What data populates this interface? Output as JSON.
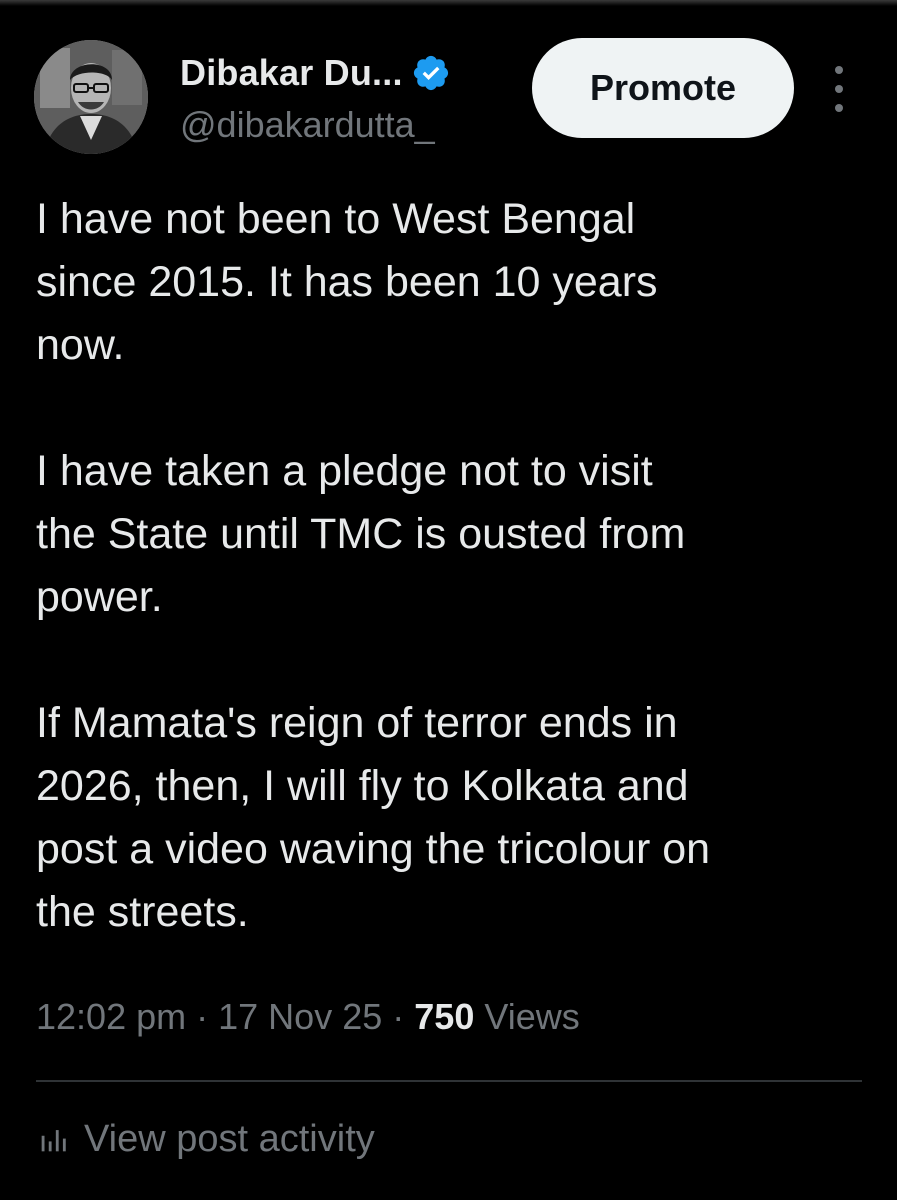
{
  "author": {
    "display_name": "Dibakar Du...",
    "handle": "@dibakardutta_",
    "verified": true,
    "verified_color": "#1d9bf0"
  },
  "actions": {
    "promote_label": "Promote",
    "more_icon": "more-vertical-icon"
  },
  "tweet": {
    "paragraphs": [
      "I have not been to West Bengal\nsince 2015. It has been  10 years\nnow.",
      "I have taken a pledge not to visit\nthe State until TMC is ousted from\npower.",
      "If Mamata's reign of terror ends in\n2026, then, I will fly to Kolkata and\npost a video waving the tricolour on\nthe streets."
    ],
    "time": "12:02 pm",
    "separator": "·",
    "date": "17 Nov 25",
    "views_count": "750",
    "views_label": "Views"
  },
  "footer": {
    "activity_icon": "bar-chart-icon",
    "activity_label": "View post activity"
  },
  "colors": {
    "background": "#000000",
    "text": "#e7e9ea",
    "secondary_text": "#71767b",
    "button_bg": "#eff3f4",
    "divider": "#2f3336"
  }
}
